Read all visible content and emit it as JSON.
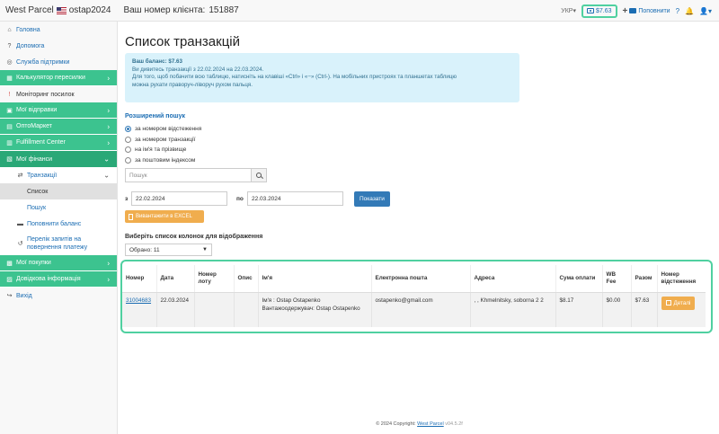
{
  "header": {
    "brand": "West Parcel",
    "username": "ostap2024",
    "client_label": "Ваш номер клієнта:",
    "client_number": "151887",
    "language": "УКР",
    "language_caret": "▾",
    "balance": "$7.63",
    "topup_label": "Поповнити",
    "help": "?",
    "bell": "🔔",
    "user_icon": "👤",
    "user_caret": "▾"
  },
  "sidebar": {
    "home": "Головна",
    "help": "Допомога",
    "support": "Служба підтримки",
    "calculator": "Калькулятор пересилки",
    "monitoring": "Моніторинг посилок",
    "my_shipments": "Мої відправки",
    "optomarket": "ОптоМаркет",
    "fulfillment": "Fulfillment Center",
    "my_finances": "Мої фінанси",
    "transactions": "Транзакції",
    "list": "Список",
    "search": "Пошук",
    "topup_balance": "Поповнити баланс",
    "payment_requests": "Перелік запитів на повернення платежу",
    "my_purchases": "Мої покупки",
    "reference": "Довідкова інформація",
    "logout": "Вихід"
  },
  "main": {
    "title": "Список транзакцій",
    "info": {
      "balance_label": "Ваш баланс:",
      "balance_value": "$7.63",
      "period_text": "Ви дивитесь транзакції з 22.02.2024 на 22.03.2024.",
      "hint_line1": "Для того, щоб побачити всю таблицю, натисніть на клавіші «Ctrl» і «−» (Ctrl-). На мобільних пристроях та планшетах таблицю",
      "hint_line2": "можна рухати праворуч-ліворуч рухом пальця."
    },
    "advanced_search_title": "Розширений пошук",
    "radio_options": [
      {
        "label": "за номером відстеження",
        "selected": true
      },
      {
        "label": "за номером транзакції",
        "selected": false
      },
      {
        "label": "на ім'я та прізвище",
        "selected": false
      },
      {
        "label": "за поштовим індексом",
        "selected": false
      }
    ],
    "search_placeholder": "Пошук",
    "date_from_label": "з",
    "date_from": "22.02.2024",
    "date_to_label": "по",
    "date_to": "22.03.2024",
    "show_button": "Показати",
    "excel_button": "Вивантажити в EXCEL",
    "columns_title": "Виберіть список колонок для відображення",
    "columns_selected": "Обрано: 11",
    "columns_caret": "▼"
  },
  "table": {
    "headers": [
      "Номер",
      "Дата",
      "Номер лоту",
      "Опис",
      "Ім'я",
      "Електронна пошта",
      "Адреса",
      "Сума оплати",
      "WB Fee",
      "Разом",
      "Номер відстеження"
    ],
    "rows": [
      {
        "number": "31004683",
        "date": "22.03.2024",
        "lot": "",
        "description": "",
        "name_line1": "Ім'я : Ostap Ostapenko",
        "name_line2": "Вантажоодержувач: Ostap Ostapenko",
        "email": "ostapenko@gmail.com",
        "address": ", , Khmelnitsky, soborna 2 2",
        "payment": "$8.17",
        "wb_fee": "$0.00",
        "total": "$7.63",
        "details_button": "Деталі"
      }
    ]
  },
  "footer": {
    "copyright": "© 2024 Copyright:",
    "link": "West Parcel",
    "version": "v04.5.2f"
  },
  "colors": {
    "accent_green": "#3cc38f",
    "highlight_border": "#4fd0a0",
    "link_blue": "#1b6db3",
    "primary_button": "#337ab7",
    "warning_button": "#f0ad4e",
    "info_bg": "#d9f2fb"
  }
}
